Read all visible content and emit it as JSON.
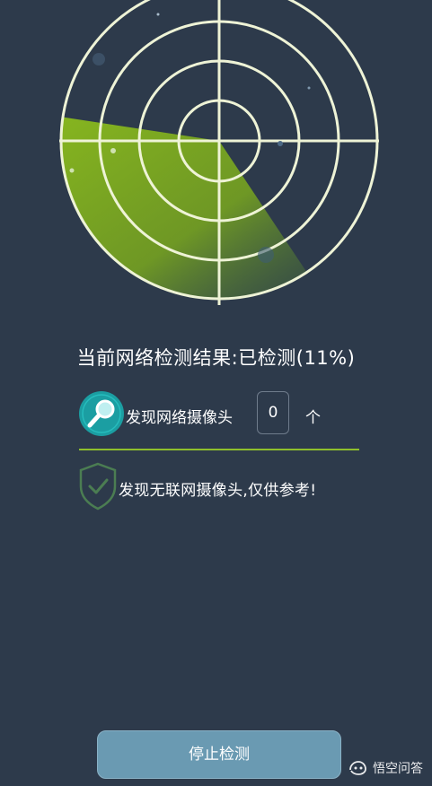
{
  "scan": {
    "status_text": "当前网络检测结果:已检测(11%)",
    "progress_percent": 11
  },
  "camera_count": {
    "label": "发现网络摄像头",
    "value": "0",
    "unit": "个",
    "icon": "search-icon"
  },
  "offline": {
    "label": "发现无联网摄像头,仅供参考!",
    "icon": "shield-check-icon"
  },
  "actions": {
    "stop_label": "停止检测"
  },
  "watermark": {
    "text": "悟空问答",
    "icon": "wukong-icon"
  },
  "colors": {
    "background": "#2d3a4b",
    "radar_lines": "#eef3d6",
    "sweep": "#8fbf2c",
    "divider": "#8fbf2c",
    "badge": "#1b9ea2",
    "button": "#6a9ab2"
  }
}
